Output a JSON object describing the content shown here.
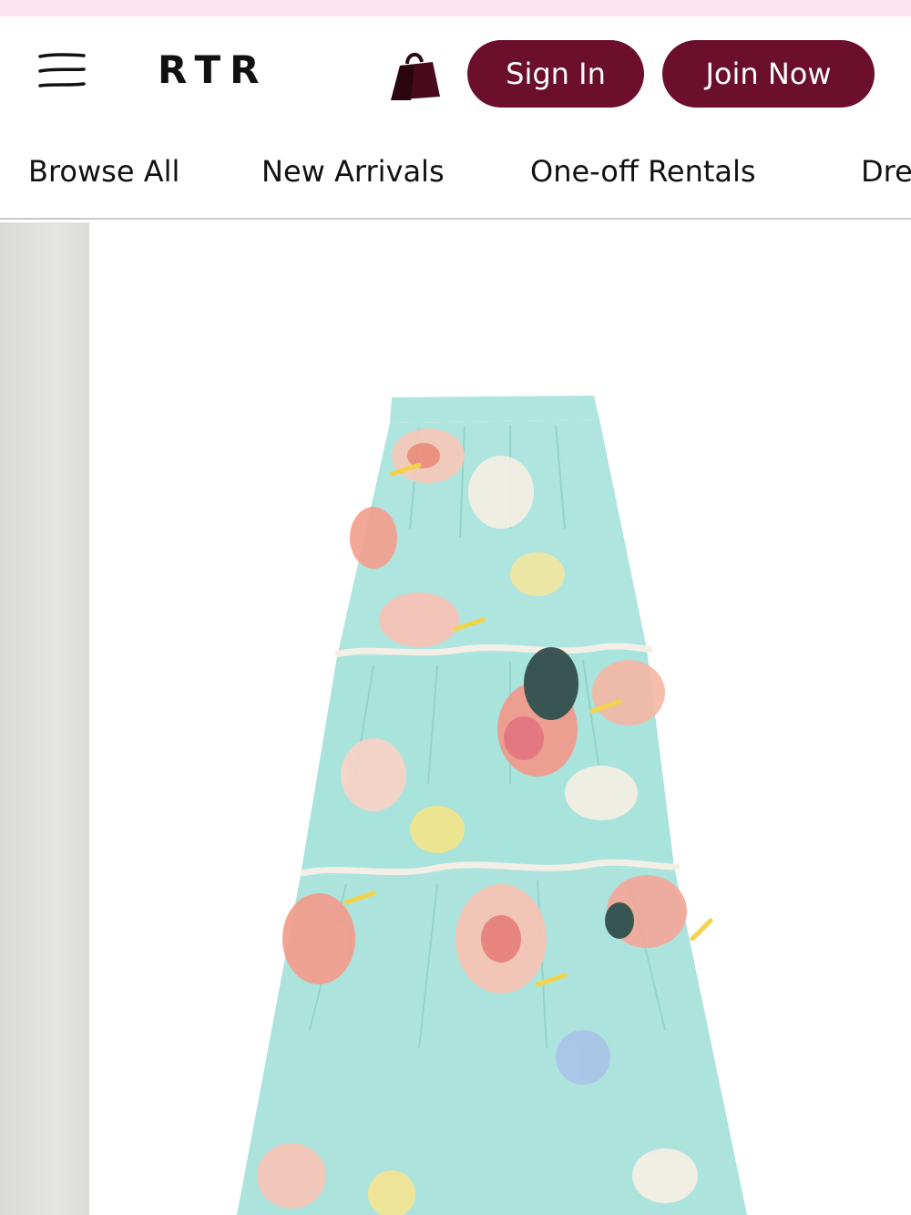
{
  "header": {
    "logo": "RTR",
    "menu_icon": "hamburger-menu-icon",
    "bag_icon": "shopping-bag-icon",
    "sign_in_label": "Sign In",
    "join_label": "Join Now"
  },
  "nav": {
    "items": [
      {
        "label": "Browse All"
      },
      {
        "label": "New Arrivals"
      },
      {
        "label": "One-off Rentals"
      },
      {
        "label": "Dresses"
      }
    ]
  },
  "colors": {
    "brand": "#6b0f2d",
    "top_strip": "#fce4ee",
    "skirt_base": "#aee6df"
  },
  "product": {
    "image": "floral-tiered-maxi-skirt"
  }
}
